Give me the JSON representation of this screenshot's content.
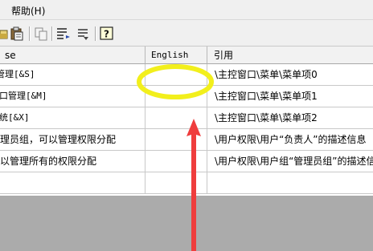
{
  "menu": {
    "help": "帮助(H)"
  },
  "toolbar": {
    "icons": [
      "open-icon",
      "paste-icon",
      "copy-icon",
      "format-icon",
      "help-icon"
    ]
  },
  "grid": {
    "headers": [
      "se",
      "English",
      "引用"
    ],
    "rows": [
      {
        "source": "管理[&S]",
        "english": "",
        "ref": "\\主控窗口\\菜单\\菜单项0"
      },
      {
        "source": "窗口管理[&M]",
        "english": "",
        "ref": "\\主控窗口\\菜单\\菜单项1"
      },
      {
        "source": "系统[&X]",
        "english": "",
        "ref": "\\主控窗口\\菜单\\菜单项2"
      },
      {
        "source": "管理员组，可以管理权限分配",
        "english": "",
        "ref": "\\用户权限\\用户“负责人”的描述信息"
      },
      {
        "source": "可以管理所有的权限分配",
        "english": "",
        "ref": "\\用户权限\\用户组“管理员组”的描述信息"
      },
      {
        "source": "",
        "english": "",
        "ref": ""
      }
    ]
  },
  "colors": {
    "highlight": "#f2ef1c",
    "arrow": "#ef3d3d"
  }
}
